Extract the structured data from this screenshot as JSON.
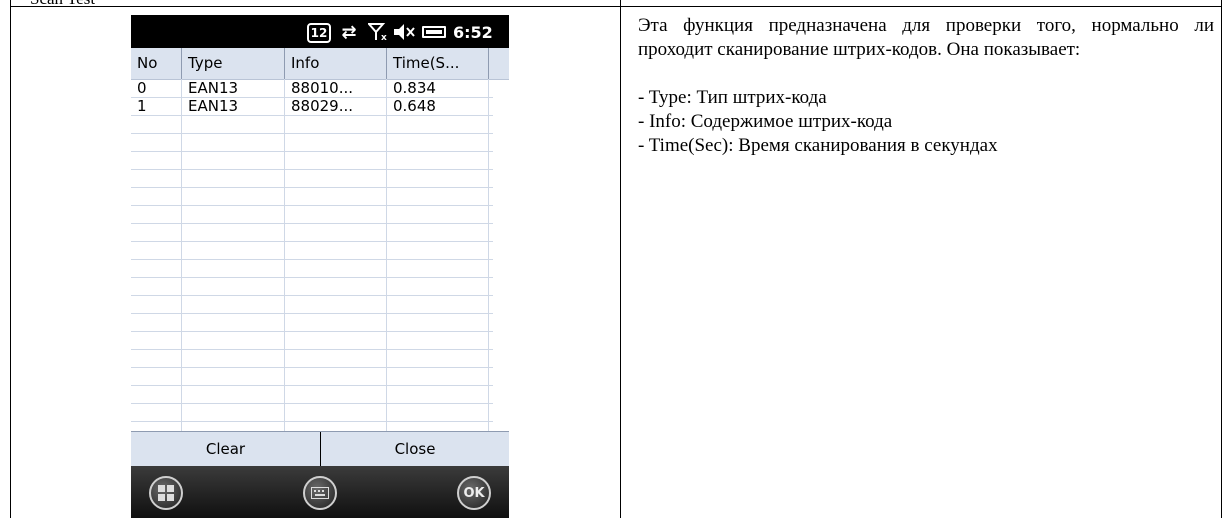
{
  "document": {
    "heading_fragment": "Scan Test"
  },
  "phone": {
    "status_bar": {
      "badge": "12",
      "time": "6:52",
      "icons": [
        "calendar-badge-icon",
        "sync-arrows-icon",
        "no-signal-icon",
        "volume-mute-icon",
        "battery-icon"
      ]
    },
    "grid": {
      "columns": [
        "No",
        "Type",
        "Info",
        "Time(S..."
      ],
      "rows": [
        {
          "no": "0",
          "type": "EAN13",
          "info": "88010...",
          "time": "0.834"
        },
        {
          "no": "1",
          "type": "EAN13",
          "info": "88029...",
          "time": "0.648"
        }
      ]
    },
    "buttons": {
      "clear": "Clear",
      "close": "Close"
    },
    "softkeys": {
      "start_icon": "windows-start-icon",
      "keyboard_icon": "keyboard-icon",
      "ok": "OK"
    }
  },
  "description": {
    "intro": "Эта функция предназначена для проверки того, нормально ли проходит сканирование штрих-кодов. Она показывает:",
    "items": [
      "- Type: Тип штрих-кода",
      "- Info: Содержимое штрих-кода",
      "- Time(Sec): Время сканирования в секундах"
    ]
  }
}
